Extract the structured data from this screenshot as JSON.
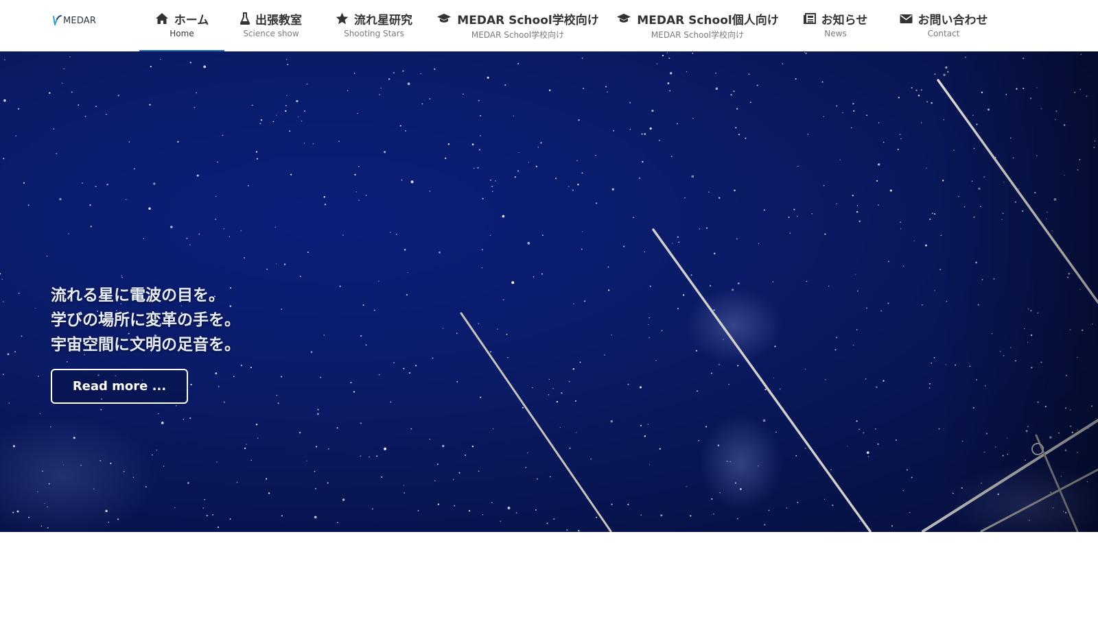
{
  "brand": {
    "logo_text": "MEDAR"
  },
  "nav": {
    "items": [
      {
        "label": "ホーム",
        "sub": "Home",
        "icon": "home-icon"
      },
      {
        "label": "出張教室",
        "sub": "Science show",
        "icon": "flask-icon"
      },
      {
        "label": "流れ星研究",
        "sub": "Shooting Stars",
        "icon": "star-icon"
      },
      {
        "label": "MEDAR School学校向け",
        "sub": "MEDAR School学校向け",
        "icon": "graduation-cap-icon"
      },
      {
        "label": "MEDAR School個人向け",
        "sub": "MEDAR School学校向け",
        "icon": "graduation-cap-icon"
      },
      {
        "label": "お知らせ",
        "sub": "News",
        "icon": "newspaper-icon"
      },
      {
        "label": "お問い合わせ",
        "sub": "Contact",
        "icon": "envelope-icon"
      }
    ],
    "active_index": 0
  },
  "hero": {
    "tagline": [
      "流れる星に電波の目を。",
      "学びの場所に変革の手を。",
      "宇宙空間に文明の足音を。"
    ],
    "button_label": "Read more ..."
  },
  "colors": {
    "accent": "#1b6fb0",
    "sky": "#0a1a63",
    "nav_text": "#333333"
  }
}
